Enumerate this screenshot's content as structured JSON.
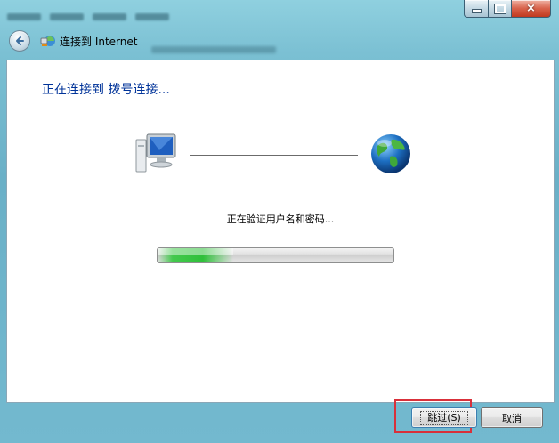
{
  "window": {
    "title": "连接到 Internet",
    "controls": {
      "minimize": "minimize",
      "maximize": "maximize",
      "close": "×"
    }
  },
  "main": {
    "heading": "正在连接到 拨号连接...",
    "status": "正在验证用户名和密码...",
    "progress": 0.32
  },
  "buttons": {
    "skip": "跳过(S)",
    "cancel": "取消"
  },
  "icons": [
    "back-arrow-icon",
    "network-connection-icon",
    "computer-icon",
    "globe-icon"
  ],
  "colors": {
    "heading": "#003399",
    "progress": "#2fc03a",
    "highlight": "#d9303a"
  }
}
